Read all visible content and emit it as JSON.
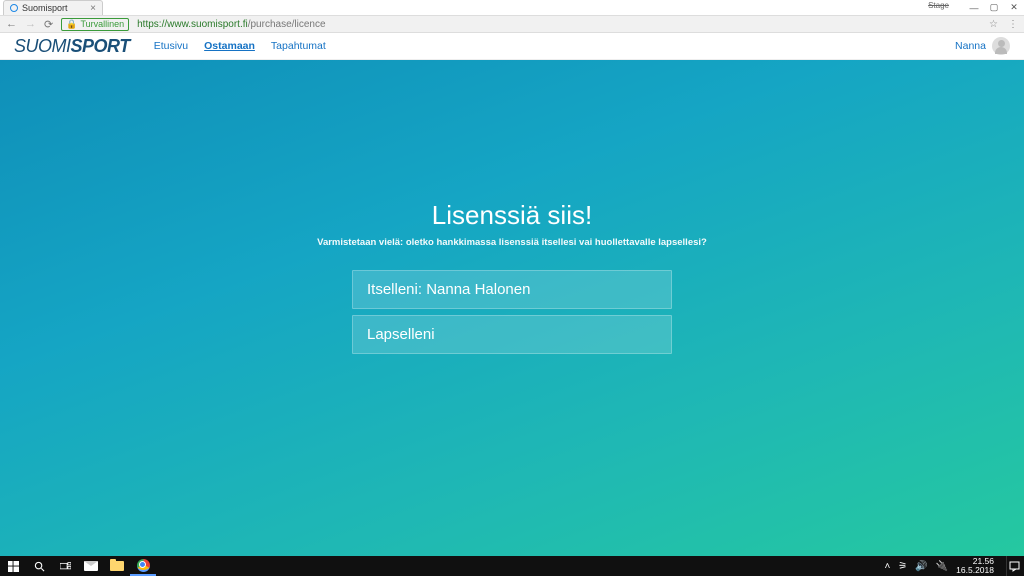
{
  "browser": {
    "tab_title": "Suomisport",
    "stage_label": "Stage",
    "secure_label": "Turvallinen",
    "url_secure": "https://www.suomisport.fi",
    "url_path": "/purchase/licence"
  },
  "header": {
    "brand_part1": "SUOMI",
    "brand_part2": "SPORT",
    "nav": {
      "home": "Etusivu",
      "buy": "Ostamaan",
      "events": "Tapahtumat"
    },
    "user_name": "Nanna"
  },
  "hero": {
    "title": "Lisenssiä siis!",
    "subtitle": "Varmistetaan vielä: oletko hankkimassa lisenssiä itsellesi vai huollettavalle lapsellesi?",
    "options": {
      "self": "Itselleni: Nanna Halonen",
      "child": "Lapselleni"
    }
  },
  "taskbar": {
    "time": "21.56",
    "date": "16.5.2018"
  }
}
